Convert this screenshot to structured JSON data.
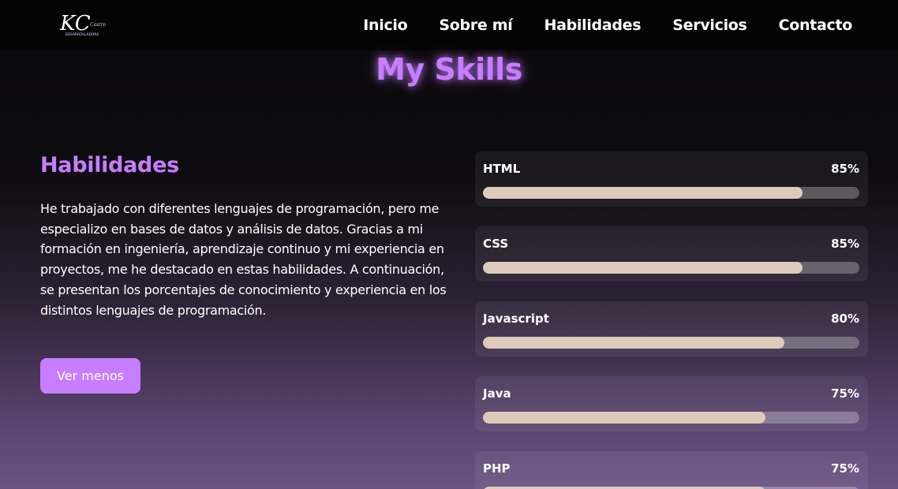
{
  "logo": {
    "monogram": "KC",
    "script": "Castro",
    "subtitle": "DESARROLLADORA"
  },
  "nav": [
    {
      "label": "Inicio"
    },
    {
      "label": "Sobre mí"
    },
    {
      "label": "Habilidades"
    },
    {
      "label": "Servicios"
    },
    {
      "label": "Contacto"
    }
  ],
  "page_title": "My Skills",
  "about": {
    "heading": "Habilidades",
    "description": "He trabajado con diferentes lenguajes de programación, pero me especializo en bases de datos y análisis de datos. Gracias a mi formación en ingeniería, aprendizaje continuo y mi experiencia en proyectos, me he destacado en estas habilidades. A continuación, se presentan los porcentajes de conocimiento y experiencia en los distintos lenguajes de programación.",
    "button_label": "Ver menos"
  },
  "skills": [
    {
      "name": "HTML",
      "percent_label": "85%",
      "value": 85
    },
    {
      "name": "CSS",
      "percent_label": "85%",
      "value": 85
    },
    {
      "name": "Javascript",
      "percent_label": "80%",
      "value": 80
    },
    {
      "name": "Java",
      "percent_label": "75%",
      "value": 75
    },
    {
      "name": "PHP",
      "percent_label": "75%",
      "value": 75
    }
  ],
  "colors": {
    "accent": "#c77dff",
    "bar_fill": "#dccbbb",
    "navbar": "#040404"
  }
}
